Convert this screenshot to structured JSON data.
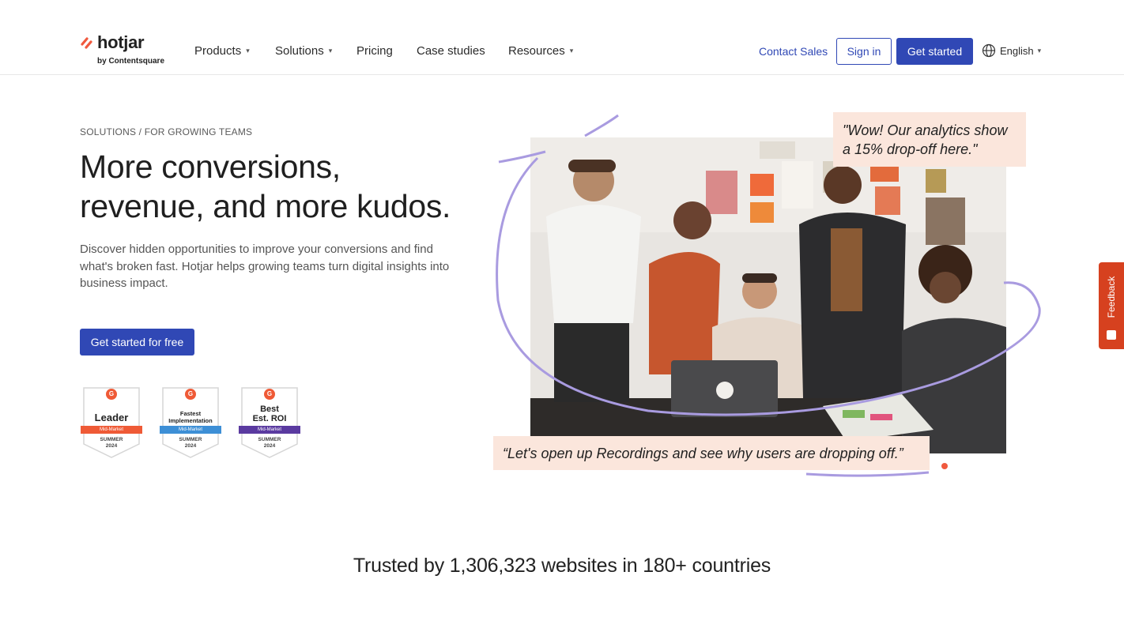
{
  "header": {
    "logo": {
      "brand": "hotjar",
      "byline": "by Contentsquare"
    },
    "nav": [
      {
        "label": "Products",
        "has_dropdown": true
      },
      {
        "label": "Solutions",
        "has_dropdown": true
      },
      {
        "label": "Pricing",
        "has_dropdown": false
      },
      {
        "label": "Case studies",
        "has_dropdown": false
      },
      {
        "label": "Resources",
        "has_dropdown": true
      }
    ],
    "contact_sales": "Contact Sales",
    "sign_in": "Sign in",
    "get_started": "Get started",
    "language": {
      "icon": "globe-icon",
      "label": "English"
    }
  },
  "hero": {
    "breadcrumb": "SOLUTIONS / FOR GROWING TEAMS",
    "title_line1": "More conversions,",
    "title_line2": "revenue, and more kudos.",
    "description": "Discover hidden opportunities to improve your conversions and find what's broken fast. Hotjar helps growing teams turn digital insights into business impact.",
    "cta": "Get started for free",
    "badges": [
      {
        "logo": "G",
        "title_lines": [
          "Leader"
        ],
        "segment": "Mid-Market",
        "season": "SUMMER",
        "year": "2024",
        "color": "#ef5a36"
      },
      {
        "logo": "G",
        "title_lines": [
          "Fastest",
          "Implementation"
        ],
        "segment": "Mid-Market",
        "season": "SUMMER",
        "year": "2024",
        "color": "#3d8fd6"
      },
      {
        "logo": "G",
        "title_lines": [
          "Best",
          "Est. ROI"
        ],
        "segment": "Mid-Market",
        "season": "SUMMER",
        "year": "2024",
        "color": "#5a3aa0"
      }
    ],
    "quote_top": "\"Wow! Our analytics show a 15% drop-off here.\"",
    "quote_bottom": "“Let's open up Recordings and see why users are dropping off.”"
  },
  "feedback_tab": {
    "label": "Feedback"
  },
  "trusted": "Trusted by 1,306,323 websites in 180+ countries",
  "colors": {
    "primary": "#3048b5",
    "brand_accent": "#f0593e",
    "quote_bg": "#fbe6dc",
    "swirl": "#a99be0",
    "feedback": "#d6411f"
  }
}
